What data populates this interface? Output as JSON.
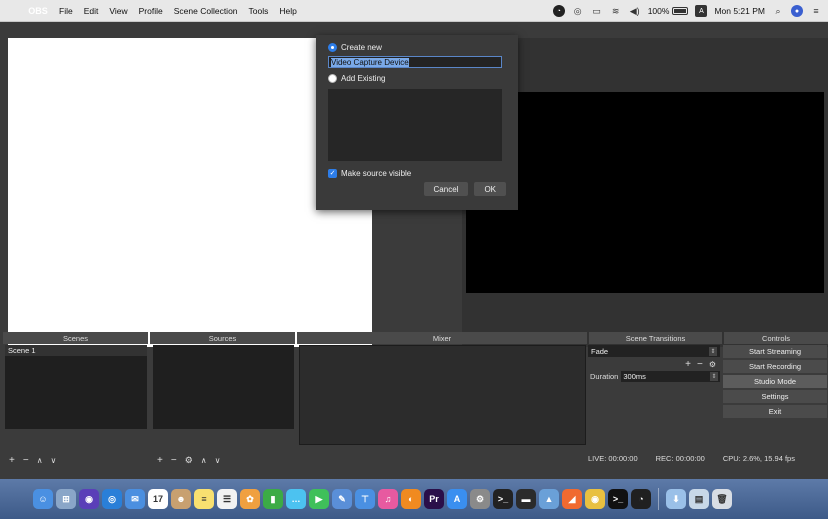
{
  "menubar": {
    "apple": "",
    "items": [
      "OBS",
      "File",
      "Edit",
      "View",
      "Profile",
      "Scene Collection",
      "Tools",
      "Help"
    ],
    "battery": "100%",
    "clock": "Mon 5:21 PM",
    "input_source": "A"
  },
  "dialog": {
    "create_new_label": "Create new",
    "source_name": "Video Capture Device",
    "add_existing_label": "Add Existing",
    "make_visible_label": "Make source visible",
    "cancel_label": "Cancel",
    "ok_label": "OK"
  },
  "docks": {
    "scenes_header": "Scenes",
    "sources_header": "Sources",
    "mixer_header": "Mixer",
    "transitions_header": "Scene Transitions",
    "controls_header": "Controls",
    "scenes": [
      "Scene 1"
    ],
    "transition": "Fade",
    "duration_label": "Duration",
    "duration_value": "300ms",
    "controls": [
      "Start Streaming",
      "Start Recording",
      "Studio Mode",
      "Settings",
      "Exit"
    ]
  },
  "status": {
    "live": "LIVE: 00:00:00",
    "rec": "REC: 00:00:00",
    "cpu": "CPU: 2.6%, 15.94 fps"
  },
  "dock_apps": [
    {
      "name": "finder",
      "color": "#4a90e2",
      "glyph": "☺"
    },
    {
      "name": "launchpad",
      "color": "#8aa6c8",
      "glyph": "⊞"
    },
    {
      "name": "siri",
      "color": "#5a3fb8",
      "glyph": "◉"
    },
    {
      "name": "safari",
      "color": "#2a7fd8",
      "glyph": "◎"
    },
    {
      "name": "mail",
      "color": "#4b8fe0",
      "glyph": "✉"
    },
    {
      "name": "calendar",
      "color": "#ffffff",
      "glyph": "17"
    },
    {
      "name": "contacts",
      "color": "#c8a070",
      "glyph": "☻"
    },
    {
      "name": "notes",
      "color": "#f8e070",
      "glyph": "≡"
    },
    {
      "name": "reminders",
      "color": "#f2f2f2",
      "glyph": "☰"
    },
    {
      "name": "photos",
      "color": "#f0a040",
      "glyph": "✿"
    },
    {
      "name": "numbers",
      "color": "#3cab46",
      "glyph": "▮"
    },
    {
      "name": "messages",
      "color": "#4cc2f0",
      "glyph": "…"
    },
    {
      "name": "facetime",
      "color": "#3fc05a",
      "glyph": "▶"
    },
    {
      "name": "pages",
      "color": "#5a8fd8",
      "glyph": "✎"
    },
    {
      "name": "keynote",
      "color": "#4a90e2",
      "glyph": "⊤"
    },
    {
      "name": "itunes",
      "color": "#e75aa0",
      "glyph": "♫"
    },
    {
      "name": "ibooks",
      "color": "#f08a20",
      "glyph": "◐"
    },
    {
      "name": "premiere",
      "color": "#2a0f4a",
      "glyph": "Pr"
    },
    {
      "name": "app-store",
      "color": "#3a8ff0",
      "glyph": "A"
    },
    {
      "name": "system-preferences",
      "color": "#8a8a8a",
      "glyph": "⚙"
    },
    {
      "name": "terminal",
      "color": "#222222",
      "glyph": ">_"
    },
    {
      "name": "xcode-like",
      "color": "#2b2b2b",
      "glyph": "▬"
    },
    {
      "name": "transmit",
      "color": "#6aa0d8",
      "glyph": "▲"
    },
    {
      "name": "swift",
      "color": "#f06a30",
      "glyph": "◢"
    },
    {
      "name": "chrome",
      "color": "#e8c040",
      "glyph": "◉"
    },
    {
      "name": "terminal2",
      "color": "#111111",
      "glyph": ">_"
    },
    {
      "name": "obs",
      "color": "#202020",
      "glyph": "◔"
    }
  ],
  "dock_right": [
    {
      "name": "downloads-stack",
      "color": "#9ac0e8",
      "glyph": "⬇"
    },
    {
      "name": "documents-stack",
      "color": "#c8d8e8",
      "glyph": "▤"
    },
    {
      "name": "trash",
      "color": "#d8dde4",
      "glyph": "🗑"
    }
  ]
}
